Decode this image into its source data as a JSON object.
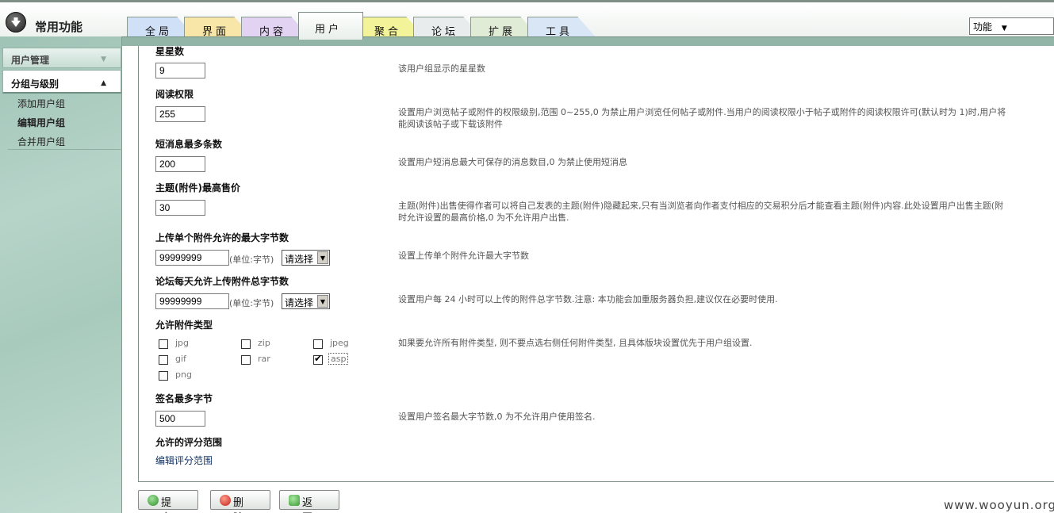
{
  "header": {
    "app_title": "常用功能",
    "tabs": [
      {
        "label": "全局",
        "color": "#cfe0f7"
      },
      {
        "label": "界面",
        "color": "#f7e6a8"
      },
      {
        "label": "内容",
        "color": "#e3d3f3"
      },
      {
        "label": "用户",
        "active": true
      },
      {
        "label": "聚合",
        "color": "#f3f39a"
      },
      {
        "label": "论坛",
        "color": "#e8ecec"
      },
      {
        "label": "扩展",
        "color": "#e1ecd7"
      },
      {
        "label": "工具",
        "color": "#d8e6f5"
      }
    ],
    "function_select": "功能"
  },
  "sidebar": {
    "sections": [
      {
        "label": "用户管理"
      },
      {
        "label": "分组与级别"
      }
    ],
    "items": [
      {
        "label": "添加用户组",
        "bold": false
      },
      {
        "label": "编辑用户组",
        "bold": true
      },
      {
        "label": "合并用户组",
        "bold": false
      }
    ]
  },
  "form": {
    "stars": {
      "label": "星星数",
      "value": "9",
      "desc": "该用户组显示的星星数"
    },
    "read_perm": {
      "label": "阅读权限",
      "value": "255",
      "desc1": "设置用户浏览帖子或附件的权限级别,范围 0~255,0 为禁止用户浏览任何帖子或附件.当用户的阅读权限小于帖子或附件的阅读权限许可(默认时为 1)时,用户将",
      "desc2": "能阅读该帖子或下载该附件"
    },
    "pm_max": {
      "label": "短消息最多条数",
      "value": "200",
      "desc": "设置用户短消息最大可保存的消息数目,0 为禁止使用短消息"
    },
    "max_price": {
      "label": "主题(附件)最高售价",
      "value": "30",
      "desc1": "主题(附件)出售使得作者可以将自己发表的主题(附件)隐藏起来,只有当浏览者向作者支付相应的交易积分后才能查看主题(附件)内容.此处设置用户出售主题(附",
      "desc2": "时允许设置的最高价格,0 为不允许用户出售."
    },
    "max_attach_size": {
      "label": "上传单个附件允许的最大字节数",
      "value": "99999999",
      "unit": "(单位:字节)",
      "select": "请选择",
      "desc": "设置上传单个附件允许最大字节数"
    },
    "max_daily_size": {
      "label": "论坛每天允许上传附件总字节数",
      "value": "99999999",
      "unit": "(单位:字节)",
      "select": "请选择",
      "desc": "设置用户每 24 小时可以上传的附件总字节数.注意: 本功能会加重服务器负担,建议仅在必要时使用."
    },
    "attach_types": {
      "label": "允许附件类型",
      "types": [
        {
          "name": "jpg",
          "checked": false
        },
        {
          "name": "zip",
          "checked": false
        },
        {
          "name": "jpeg",
          "checked": false
        },
        {
          "name": "gif",
          "checked": false
        },
        {
          "name": "rar",
          "checked": false
        },
        {
          "name": "asp",
          "checked": true
        },
        {
          "name": "png",
          "checked": false
        }
      ],
      "desc": "如果要允许所有附件类型, 则不要点选右侧任何附件类型, 且具体版块设置优先于用户组设置."
    },
    "sig_max": {
      "label": "签名最多字节",
      "value": "500",
      "desc": "设置用户签名最大字节数,0 为不允许用户使用签名."
    },
    "rating": {
      "label": "允许的评分范围",
      "link": "编辑评分范围"
    }
  },
  "buttons": {
    "submit": "提 交",
    "delete": "删 除",
    "back": "返 回"
  },
  "watermark": "www.wooyun.org"
}
